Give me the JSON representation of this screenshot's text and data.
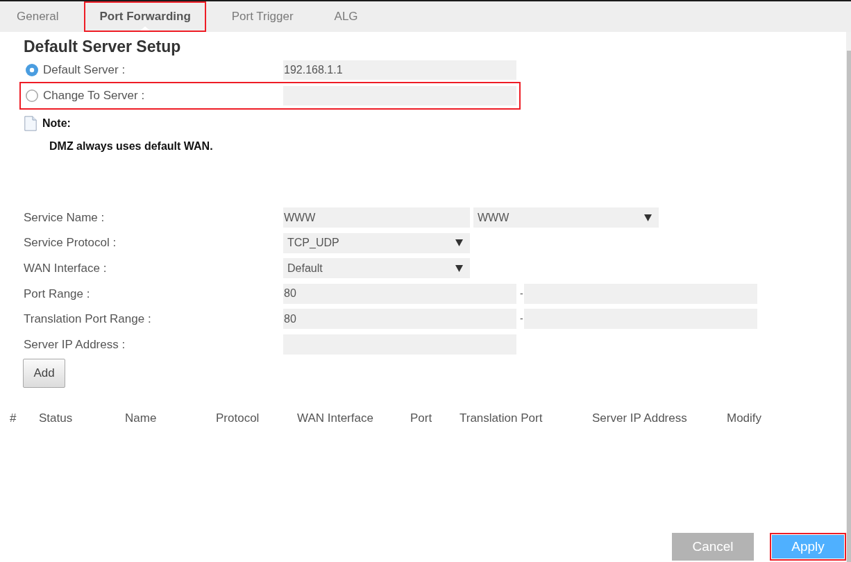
{
  "tabs": [
    {
      "label": "General",
      "selected": false,
      "highlighted": false
    },
    {
      "label": "Port Forwarding",
      "selected": true,
      "highlighted": true
    },
    {
      "label": "Port Trigger",
      "selected": false,
      "highlighted": false
    },
    {
      "label": "ALG",
      "selected": false,
      "highlighted": false
    }
  ],
  "default_server_setup": {
    "title": "Default Server Setup",
    "options": [
      {
        "label": "Default Server :",
        "selected": true,
        "highlighted": false,
        "value": "192.168.1.1"
      },
      {
        "label": "Change To Server :",
        "selected": false,
        "highlighted": true
      }
    ],
    "note": {
      "title": "Note:",
      "text": "DMZ always uses default WAN."
    }
  },
  "form": {
    "fields": [
      {
        "label": "Service Name :",
        "kind": "input_select",
        "value": "WWW",
        "select_value": "WWW"
      },
      {
        "label": "Service Protocol :",
        "kind": "select",
        "value": "TCP_UDP"
      },
      {
        "label": "WAN Interface :",
        "kind": "select",
        "value": "Default"
      },
      {
        "label": "Port Range :",
        "kind": "range",
        "value": "80",
        "separator": "-"
      },
      {
        "label": "Translation Port Range :",
        "kind": "range",
        "value": "80",
        "separator": "-"
      },
      {
        "label": "Server IP Address :",
        "kind": "input"
      }
    ],
    "add_button": "Add"
  },
  "table": {
    "columns": [
      "#",
      "Status",
      "Name",
      "Protocol",
      "WAN Interface",
      "Port",
      "Translation Port",
      "Server IP Address",
      "Modify"
    ]
  },
  "buttons": [
    {
      "label": "Cancel",
      "kind": "secondary",
      "highlighted": false
    },
    {
      "label": "Apply",
      "kind": "primary",
      "highlighted": true
    }
  ]
}
